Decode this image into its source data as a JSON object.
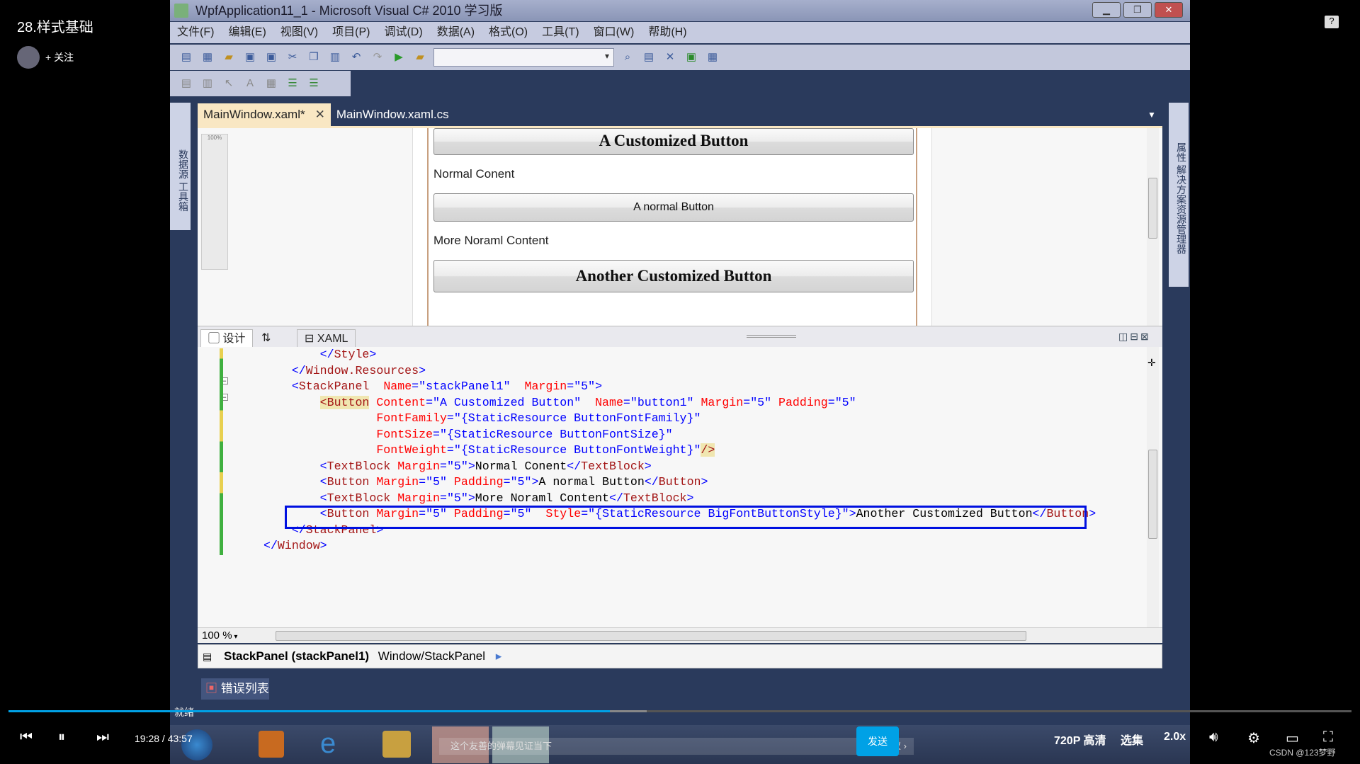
{
  "video": {
    "title": "28.样式基础",
    "follow": "+ 关注",
    "time_current": "19:28",
    "time_total": "43:57",
    "progress_percent": 44.8,
    "buffered_percent": 47.5,
    "quality": "720P 高清",
    "episodes": "选集",
    "speed": "2.0x",
    "danmaku_placeholder": "这个友善的弹幕见证当下",
    "danmaku_etiquette": "弹幕礼仪 ›",
    "send": "发送",
    "watermark": "CSDN @123梦野",
    "accent": "#00a1e6"
  },
  "window": {
    "title": "WpfApplication11_1 - Microsoft Visual C# 2010 学习版"
  },
  "menu": [
    "文件(F)",
    "编辑(E)",
    "视图(V)",
    "项目(P)",
    "调试(D)",
    "数据(A)",
    "格式(O)",
    "工具(T)",
    "窗口(W)",
    "帮助(H)"
  ],
  "side": {
    "left": "数据源 工具箱",
    "right": "属性 解决方案资源管理器"
  },
  "tabs": [
    {
      "label": "MainWindow.xaml*",
      "active": true
    },
    {
      "label": "MainWindow.xaml.cs",
      "active": false
    }
  ],
  "preview": {
    "button1": "A Customized Button",
    "text1": "Normal Conent",
    "button2": "A normal Button",
    "text2": "More Noraml Content",
    "button3": "Another Customized Button",
    "zoom": "100%"
  },
  "split": {
    "design": "设计",
    "swap": "⇅",
    "xaml": "XAML"
  },
  "code_colors": {
    "bracket": "#0000ff",
    "element": "#a31515",
    "attribute": "#ff0000",
    "value": "#0000ff",
    "highlight_box": "#0010e0"
  },
  "code": [
    [
      {
        "c": "s",
        "t": "        "
      },
      {
        "c": "b",
        "t": "</"
      },
      {
        "c": "e",
        "t": "Style"
      },
      {
        "c": "b",
        "t": ">"
      }
    ],
    [
      {
        "c": "s",
        "t": "    "
      },
      {
        "c": "b",
        "t": "</"
      },
      {
        "c": "e",
        "t": "Window.Resources"
      },
      {
        "c": "b",
        "t": ">"
      }
    ],
    [
      {
        "c": "s",
        "t": "    "
      },
      {
        "c": "b",
        "t": "<"
      },
      {
        "c": "e",
        "t": "StackPanel"
      },
      {
        "c": "a",
        "t": "  Name"
      },
      {
        "c": "b",
        "t": "="
      },
      {
        "c": "v",
        "t": "\"stackPanel1\""
      },
      {
        "c": "a",
        "t": "  Margin"
      },
      {
        "c": "b",
        "t": "="
      },
      {
        "c": "v",
        "t": "\"5\""
      },
      {
        "c": "b",
        "t": ">"
      }
    ],
    [
      {
        "c": "s",
        "t": "        "
      },
      {
        "c": "hl",
        "t": "<Button"
      },
      {
        "c": "a",
        "t": " Content"
      },
      {
        "c": "b",
        "t": "="
      },
      {
        "c": "v",
        "t": "\"A Customized Button\""
      },
      {
        "c": "a",
        "t": "  Name"
      },
      {
        "c": "b",
        "t": "="
      },
      {
        "c": "v",
        "t": "\"button1\""
      },
      {
        "c": "a",
        "t": " Margin"
      },
      {
        "c": "b",
        "t": "="
      },
      {
        "c": "v",
        "t": "\"5\""
      },
      {
        "c": "a",
        "t": " Padding"
      },
      {
        "c": "b",
        "t": "="
      },
      {
        "c": "v",
        "t": "\"5\""
      }
    ],
    [
      {
        "c": "s",
        "t": "                "
      },
      {
        "c": "a",
        "t": "FontFamily"
      },
      {
        "c": "b",
        "t": "="
      },
      {
        "c": "v",
        "t": "\"{StaticResource ButtonFontFamily}\""
      }
    ],
    [
      {
        "c": "s",
        "t": "                "
      },
      {
        "c": "a",
        "t": "FontSize"
      },
      {
        "c": "b",
        "t": "="
      },
      {
        "c": "v",
        "t": "\"{StaticResource ButtonFontSize}\""
      }
    ],
    [
      {
        "c": "s",
        "t": "                "
      },
      {
        "c": "a",
        "t": "FontWeight"
      },
      {
        "c": "b",
        "t": "="
      },
      {
        "c": "v",
        "t": "\"{StaticResource ButtonFontWeight}\""
      },
      {
        "c": "hl",
        "t": "/>"
      }
    ],
    [
      {
        "c": "s",
        "t": "        "
      },
      {
        "c": "b",
        "t": "<"
      },
      {
        "c": "e",
        "t": "TextBlock"
      },
      {
        "c": "a",
        "t": " Margin"
      },
      {
        "c": "b",
        "t": "="
      },
      {
        "c": "v",
        "t": "\"5\""
      },
      {
        "c": "b",
        "t": ">"
      },
      {
        "c": "x",
        "t": "Normal Conent"
      },
      {
        "c": "b",
        "t": "</"
      },
      {
        "c": "e",
        "t": "TextBlock"
      },
      {
        "c": "b",
        "t": ">"
      }
    ],
    [
      {
        "c": "s",
        "t": "        "
      },
      {
        "c": "b",
        "t": "<"
      },
      {
        "c": "e",
        "t": "Button"
      },
      {
        "c": "a",
        "t": " Margin"
      },
      {
        "c": "b",
        "t": "="
      },
      {
        "c": "v",
        "t": "\"5\""
      },
      {
        "c": "a",
        "t": " Padding"
      },
      {
        "c": "b",
        "t": "="
      },
      {
        "c": "v",
        "t": "\"5\""
      },
      {
        "c": "b",
        "t": ">"
      },
      {
        "c": "x",
        "t": "A normal Button"
      },
      {
        "c": "b",
        "t": "</"
      },
      {
        "c": "e",
        "t": "Button"
      },
      {
        "c": "b",
        "t": ">"
      }
    ],
    [
      {
        "c": "s",
        "t": "        "
      },
      {
        "c": "b",
        "t": "<"
      },
      {
        "c": "e",
        "t": "TextBlock"
      },
      {
        "c": "a",
        "t": " Margin"
      },
      {
        "c": "b",
        "t": "="
      },
      {
        "c": "v",
        "t": "\"5\""
      },
      {
        "c": "b",
        "t": ">"
      },
      {
        "c": "x",
        "t": "More Noraml Content"
      },
      {
        "c": "b",
        "t": "</"
      },
      {
        "c": "e",
        "t": "TextBlock"
      },
      {
        "c": "b",
        "t": ">"
      }
    ],
    [
      {
        "c": "s",
        "t": "        "
      },
      {
        "c": "b",
        "t": "<"
      },
      {
        "c": "e",
        "t": "Button"
      },
      {
        "c": "a",
        "t": " Margin"
      },
      {
        "c": "b",
        "t": "="
      },
      {
        "c": "v",
        "t": "\"5\""
      },
      {
        "c": "a",
        "t": " Padding"
      },
      {
        "c": "b",
        "t": "="
      },
      {
        "c": "v",
        "t": "\"5\""
      },
      {
        "c": "a",
        "t": "  Style"
      },
      {
        "c": "b",
        "t": "="
      },
      {
        "c": "v",
        "t": "\"{StaticResource BigFontButtonStyle}\""
      },
      {
        "c": "b",
        "t": ">"
      },
      {
        "c": "x",
        "t": "Another Customized Button"
      },
      {
        "c": "b",
        "t": "</"
      },
      {
        "c": "e",
        "t": "Button"
      },
      {
        "c": "b",
        "t": ">"
      }
    ],
    [
      {
        "c": "s",
        "t": "    "
      },
      {
        "c": "b",
        "t": "</"
      },
      {
        "c": "e",
        "t": "StackPanel"
      },
      {
        "c": "b",
        "t": ">"
      }
    ],
    [
      {
        "c": "b",
        "t": "</"
      },
      {
        "c": "e",
        "t": "Window"
      },
      {
        "c": "b",
        "t": ">"
      }
    ]
  ],
  "editor_zoom": "100 %",
  "breadcrumb": {
    "current": "StackPanel (stackPanel1)",
    "path": "Window/StackPanel"
  },
  "error_list": "错误列表",
  "status": "就绪"
}
